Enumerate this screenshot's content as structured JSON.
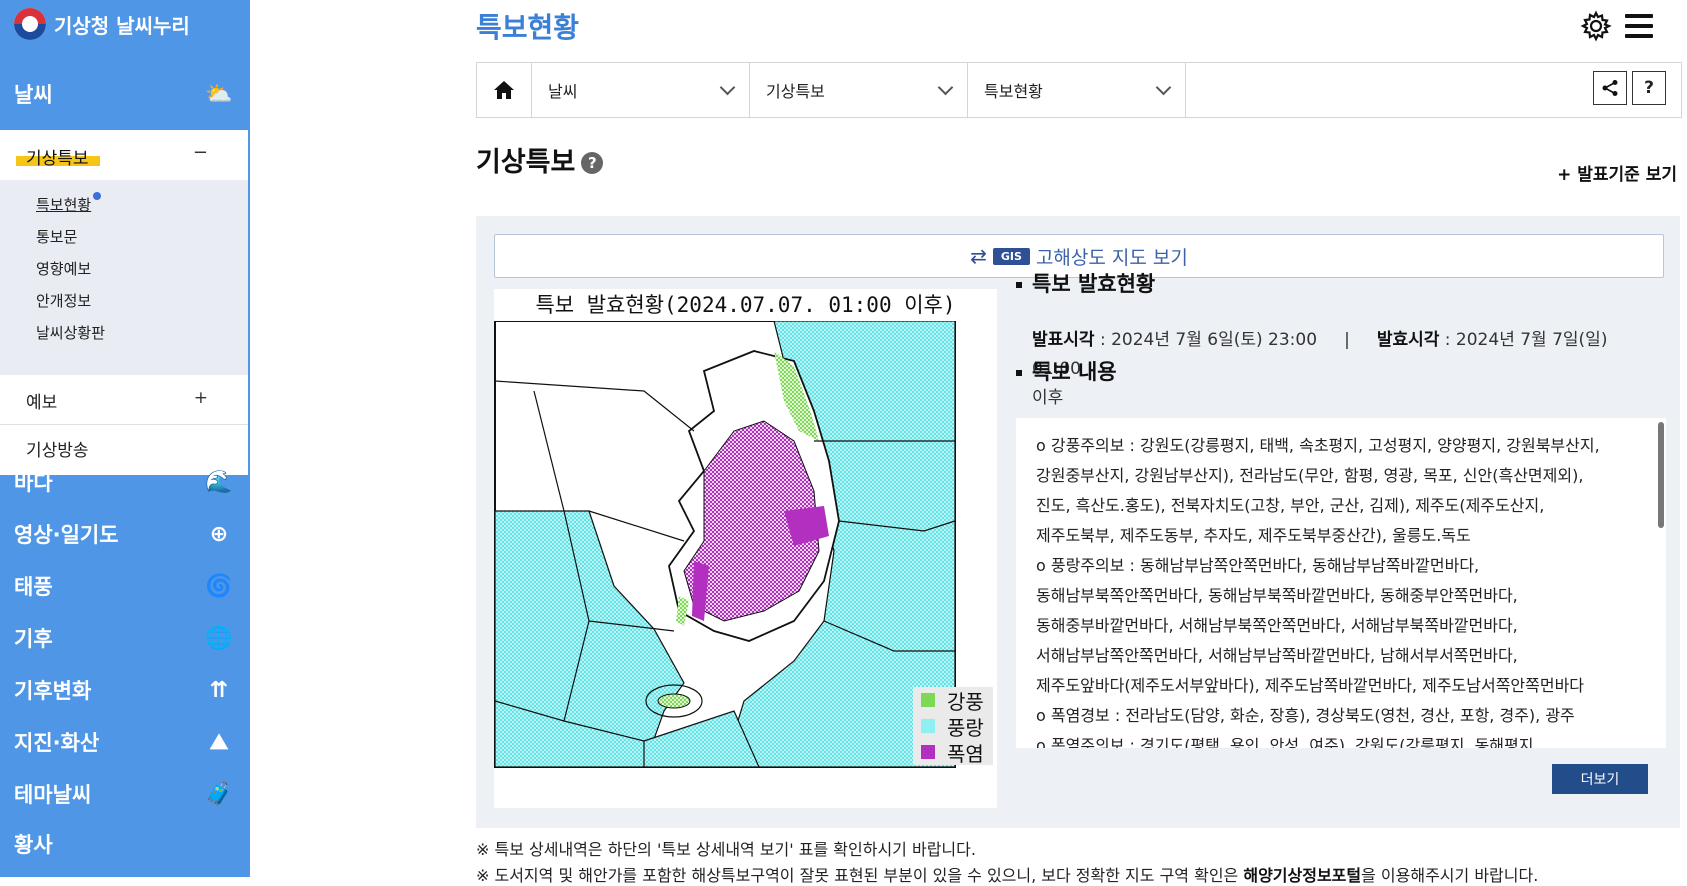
{
  "app": {
    "name": "기상청 날씨누리"
  },
  "sidebar": {
    "menus": [
      {
        "label": "날씨",
        "icon": "weather-icon"
      },
      {
        "label": "바다",
        "icon": "wave-icon"
      },
      {
        "label": "영상·일기도",
        "icon": "satellite-icon"
      },
      {
        "label": "태풍",
        "icon": "typhoon-icon"
      },
      {
        "label": "기후",
        "icon": "globe-icon"
      },
      {
        "label": "기후변화",
        "icon": "climate-change-icon"
      },
      {
        "label": "지진·화산",
        "icon": "earthquake-icon"
      },
      {
        "label": "테마날씨",
        "icon": "theme-bag-icon"
      },
      {
        "label": "황사"
      }
    ],
    "submenu": {
      "label": "기상특보",
      "toggle": "−",
      "items": [
        "특보현황",
        "통보문",
        "영향예보",
        "안개정보",
        "날씨상황판"
      ],
      "groups": [
        {
          "label": "예보",
          "toggle": "+"
        },
        {
          "label": "기상방송",
          "toggle": ""
        }
      ]
    }
  },
  "header": {
    "title": "특보현황"
  },
  "breadcrumb": {
    "items": [
      "날씨",
      "기상특보",
      "특보현황"
    ],
    "help": "?"
  },
  "section": {
    "title": "기상특보",
    "help": "?",
    "criteria": "+ 발표기준 보기"
  },
  "gis": {
    "badge": "GIS",
    "label": "고해상도 지도 보기"
  },
  "map": {
    "title": "특보 발효현황(2024.07.07. 01:00 이후)",
    "legend": [
      {
        "label": "강풍",
        "color": "#7ed957"
      },
      {
        "label": "풍랑",
        "color": "#8ef0f0"
      },
      {
        "label": "폭염",
        "color": "#b22fc0"
      }
    ]
  },
  "status": {
    "heading": "특보 발효현황",
    "announce_label": "발표시각",
    "announce_value": " : 2024년 7월 6일(토) 23:00",
    "sep": "|",
    "effective_label": "발효시각",
    "effective_value": " : 2024년 7월 7일(일) 01:00",
    "effective_suffix": "이후"
  },
  "content": {
    "heading": "특보 내용",
    "lines": [
      "o 강풍주의보 : 강원도(강릉평지, 태백, 속초평지, 고성평지, 양양평지, 강원북부산지,",
      "강원중부산지, 강원남부산지), 전라남도(무안, 함평, 영광, 목포, 신안(흑산면제외),",
      "진도, 흑산도.홍도), 전북자치도(고창, 부안, 군산, 김제), 제주도(제주도산지,",
      "제주도북부, 제주도동부, 추자도, 제주도북부중산간), 울릉도.독도",
      "o 풍랑주의보 : 동해남부남쪽안쪽먼바다, 동해남부남쪽바깥먼바다,",
      "동해남부북쪽안쪽먼바다, 동해남부북쪽바깥먼바다, 동해중부안쪽먼바다,",
      "동해중부바깥먼바다, 서해남부북쪽안쪽먼바다, 서해남부북쪽바깥먼바다,",
      "서해남부남쪽안쪽먼바다, 서해남부남쪽바깥먼바다, 남해서부서쪽먼바다,",
      "제주도앞바다(제주도서부앞바다), 제주도남쪽바깥먼바다, 제주도남서쪽안쪽먼바다",
      "o 폭염경보 : 전라남도(담양, 화순, 장흥), 경상북도(영천, 경산, 포항, 경주), 광주",
      "o 폭염주의보 : 경기도(평택, 용인, 안성, 여주), 강원도(강릉평지, 동해평지,"
    ],
    "more": "더보기"
  },
  "notes": {
    "n1": "※ 특보 상세내역은 하단의 '특보 상세내역 보기' 표를 확인하시기 바랍니다.",
    "n2a": "※ 도서지역 및 해안가를 포함한 해상특보구역이 잘못 표현된 부분이 있을 수 있으니, 보다 정확한 지도 구역 확인은 ",
    "n2b": "해양기상정보포털",
    "n2c": "을 이용해주시기 바랍니다."
  }
}
